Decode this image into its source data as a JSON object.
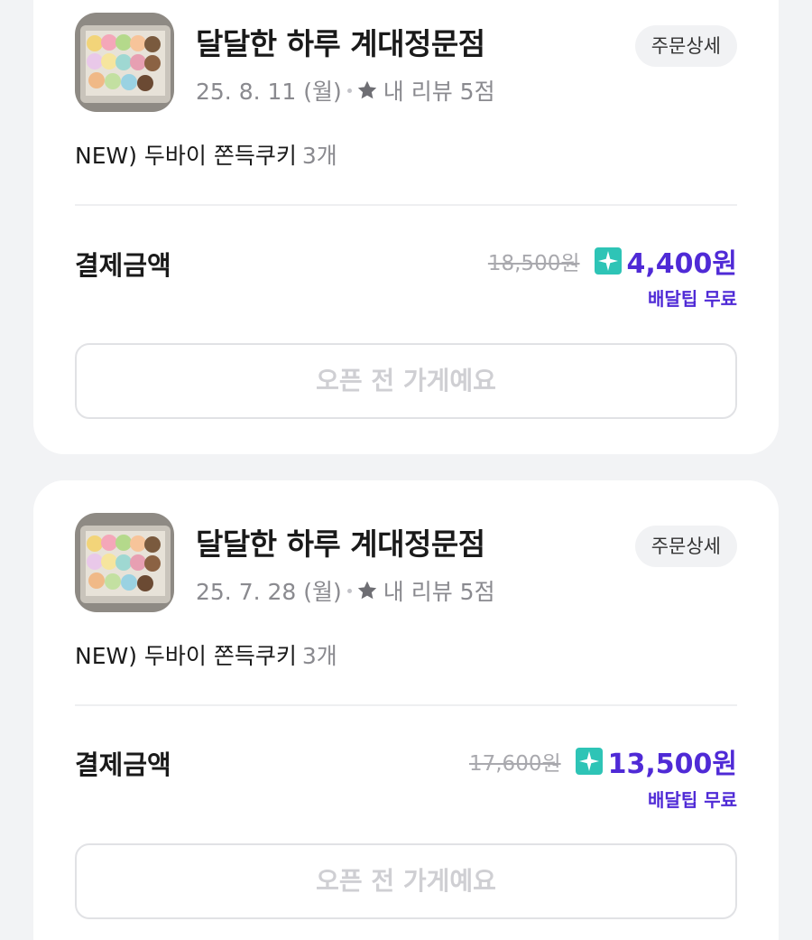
{
  "orders": [
    {
      "store_name": "달달한 하루 계대정문점",
      "date": "25. 8. 11 (월)",
      "review": "내 리뷰 5점",
      "detail_button": "주문상세",
      "menu_item": "NEW) 두바이 쫀득쿠키",
      "quantity": "3개",
      "payment_label": "결제금액",
      "original_price": "18,500원",
      "final_price": "4,400원",
      "delivery_tip": "배달팁 무료",
      "status_button": "오픈 전 가게예요"
    },
    {
      "store_name": "달달한 하루 계대정문점",
      "date": "25. 7. 28 (월)",
      "review": "내 리뷰 5점",
      "detail_button": "주문상세",
      "menu_item": "NEW) 두바이 쫀득쿠키",
      "quantity": "3개",
      "payment_label": "결제금액",
      "original_price": "17,600원",
      "final_price": "13,500원",
      "delivery_tip": "배달팁 무료",
      "status_button": "오픈 전 가게예요"
    }
  ],
  "colors": {
    "accent": "#4f2ad6",
    "badge_teal": "#2ec4b6",
    "background": "#f2f3f5"
  },
  "icons": {
    "review_star": "star-icon",
    "plus_badge": "sparkle-badge-icon"
  }
}
